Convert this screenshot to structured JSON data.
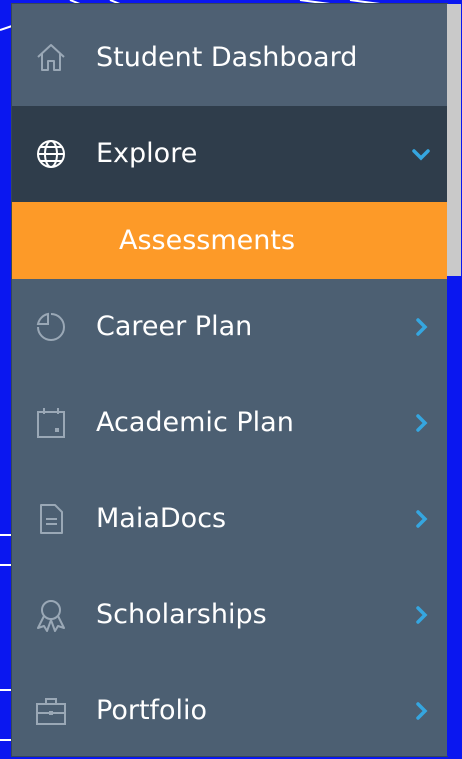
{
  "menu": {
    "items": [
      {
        "label": "Student Dashboard",
        "icon": "home-icon"
      },
      {
        "label": "Explore",
        "icon": "globe-icon",
        "expanded": true
      },
      {
        "label": "Career Plan",
        "icon": "pie-chart-icon"
      },
      {
        "label": "Academic Plan",
        "icon": "calendar-icon"
      },
      {
        "label": "MaiaDocs",
        "icon": "document-icon"
      },
      {
        "label": "Scholarships",
        "icon": "award-ribbon-icon"
      },
      {
        "label": "Portfolio",
        "icon": "briefcase-icon"
      }
    ],
    "submenu": [
      {
        "label": "Assessments"
      }
    ]
  },
  "colors": {
    "menu_bg": "#4c5f72",
    "active_bg": "#2f3d4b",
    "selected_bg": "#fd9a28",
    "chevron": "#35a6e0",
    "icon_muted": "#9aa8b6",
    "backdrop": "#0a17f0"
  }
}
